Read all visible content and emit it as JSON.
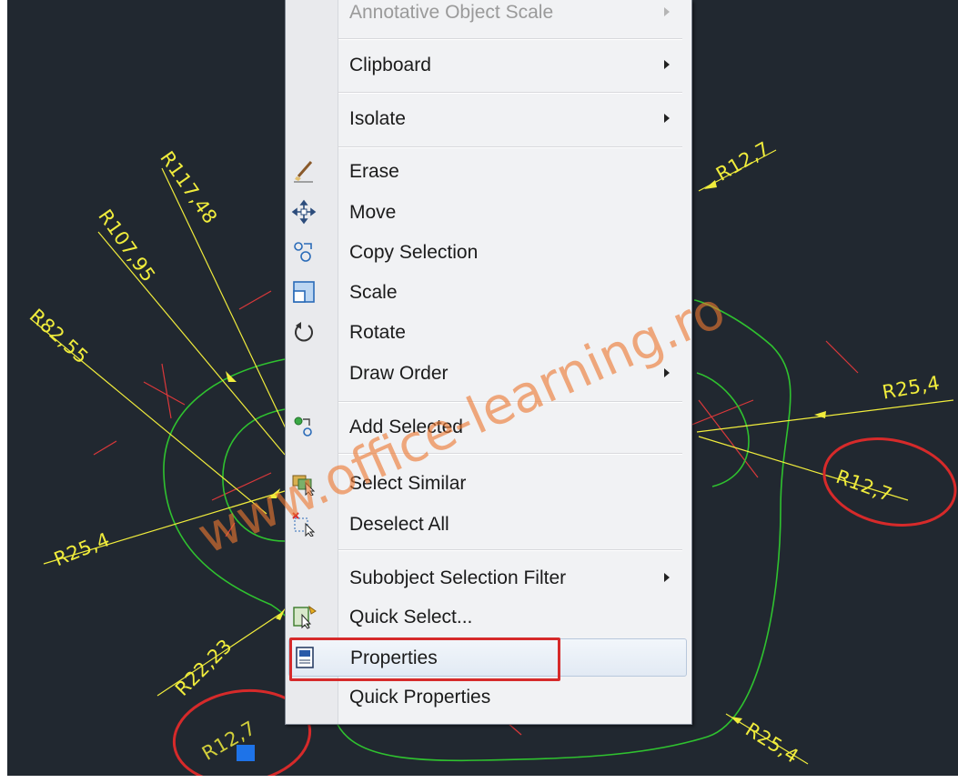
{
  "menu": {
    "items": [
      {
        "label": "Annotative Object Scale",
        "submenu": true,
        "icon": "",
        "faded": true
      },
      {
        "label": "Clipboard",
        "submenu": true,
        "icon": ""
      },
      {
        "label": "Isolate",
        "submenu": true,
        "icon": ""
      },
      {
        "label": "Erase",
        "submenu": false,
        "icon": "eraser-icon"
      },
      {
        "label": "Move",
        "submenu": false,
        "icon": "move-icon"
      },
      {
        "label": "Copy Selection",
        "submenu": false,
        "icon": "copy-selection-icon"
      },
      {
        "label": "Scale",
        "submenu": false,
        "icon": "scale-icon"
      },
      {
        "label": "Rotate",
        "submenu": false,
        "icon": "rotate-icon"
      },
      {
        "label": "Draw Order",
        "submenu": true,
        "icon": ""
      },
      {
        "label": "Add Selected",
        "submenu": false,
        "icon": "add-selected-icon"
      },
      {
        "label": "Select Similar",
        "submenu": false,
        "icon": "select-similar-icon"
      },
      {
        "label": "Deselect All",
        "submenu": false,
        "icon": "deselect-all-icon"
      },
      {
        "label": "Subobject Selection Filter",
        "submenu": true,
        "icon": ""
      },
      {
        "label": "Quick Select...",
        "submenu": false,
        "icon": "quick-select-icon"
      },
      {
        "label": "Properties",
        "submenu": false,
        "icon": "properties-icon",
        "hovered": true
      },
      {
        "label": "Quick Properties",
        "submenu": false,
        "icon": ""
      }
    ]
  },
  "drawing": {
    "dimensions": [
      {
        "text": "R117,48"
      },
      {
        "text": "R107,95"
      },
      {
        "text": "R82,55"
      },
      {
        "text": "R25,4"
      },
      {
        "text": "R22,23"
      },
      {
        "text": "R12,7"
      },
      {
        "text": "R12,7"
      },
      {
        "text": "R25,4"
      },
      {
        "text": "R12,7"
      },
      {
        "text": "R25,4"
      }
    ],
    "watermark": "www.office-learning.ro"
  },
  "colors": {
    "background": "#212830",
    "geometry": "#2fc22f",
    "dimension": "#f0ec3c",
    "centerline": "#d9383a",
    "annotation": "#d62a2a",
    "grip": "#1e73e8"
  }
}
